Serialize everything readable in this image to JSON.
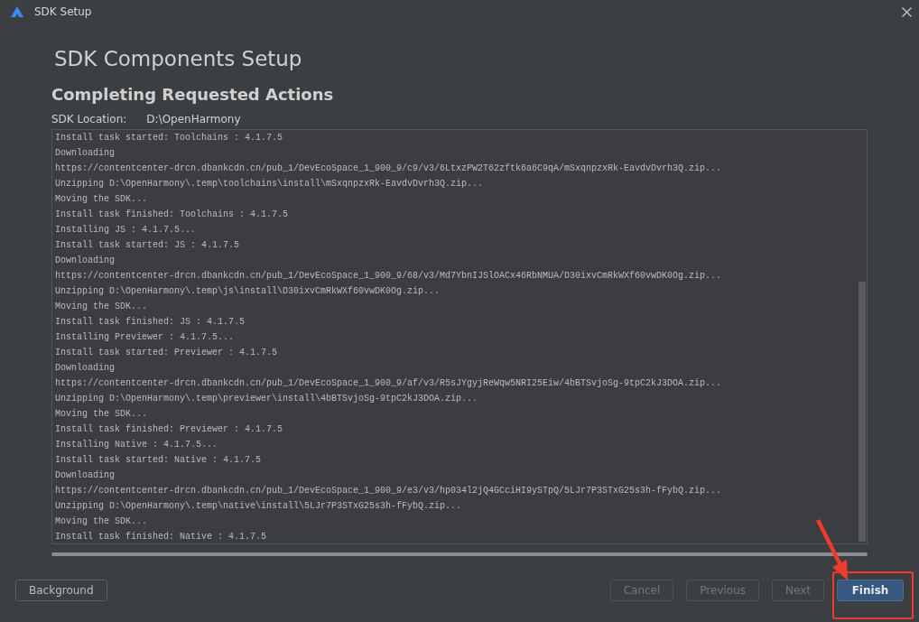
{
  "window": {
    "title": "SDK Setup"
  },
  "page_title": "SDK Components Setup",
  "section_title": "Completing Requested Actions",
  "sdk_location": {
    "label": "SDK Location:",
    "value": "D:\\OpenHarmony"
  },
  "log_lines": [
    "Install task started: Toolchains : 4.1.7.5",
    "Downloading",
    "https://contentcenter-drcn.dbankcdn.cn/pub_1/DevEcoSpace_1_900_9/c9/v3/6LtxzPW2T62zftk6a6C9qA/mSxqnpzxRk-EavdvDvrh3Q.zip...",
    "Unzipping D:\\OpenHarmony\\.temp\\toolchains\\install\\mSxqnpzxRk-EavdvDvrh3Q.zip...",
    "Moving the SDK...",
    "Install task finished: Toolchains : 4.1.7.5",
    "Installing JS : 4.1.7.5...",
    "Install task started: JS : 4.1.7.5",
    "Downloading",
    "https://contentcenter-drcn.dbankcdn.cn/pub_1/DevEcoSpace_1_900_9/68/v3/Md7YbnIJSlOACx46RbNMUA/D30ixvCmRkWXf60vwDK0Og.zip...",
    "Unzipping D:\\OpenHarmony\\.temp\\js\\install\\D30ixvCmRkWXf60vwDK0Og.zip...",
    "Moving the SDK...",
    "Install task finished: JS : 4.1.7.5",
    "Installing Previewer : 4.1.7.5...",
    "Install task started: Previewer : 4.1.7.5",
    "Downloading",
    "https://contentcenter-drcn.dbankcdn.cn/pub_1/DevEcoSpace_1_900_9/af/v3/R5sJYgyjReWqw5NRI25Eiw/4bBTSvjoSg-9tpC2kJ3DOA.zip...",
    "Unzipping D:\\OpenHarmony\\.temp\\previewer\\install\\4bBTSvjoSg-9tpC2kJ3DOA.zip...",
    "Moving the SDK...",
    "Install task finished: Previewer : 4.1.7.5",
    "Installing Native : 4.1.7.5...",
    "Install task started: Native : 4.1.7.5",
    "Downloading",
    "https://contentcenter-drcn.dbankcdn.cn/pub_1/DevEcoSpace_1_900_9/e3/v3/hp034l2jQ4GCciHI9ySTpQ/5LJr7P3STxG25s3h-fFybQ.zip...",
    "Unzipping D:\\OpenHarmony\\.temp\\native\\install\\5LJr7P3STxG25s3h-fFybQ.zip...",
    "Moving the SDK...",
    "Install task finished: Native : 4.1.7.5"
  ],
  "left_button": {
    "label": "Background",
    "disabled": false
  },
  "buttons": [
    {
      "label": "Cancel",
      "disabled": true,
      "primary": false
    },
    {
      "label": "Previous",
      "disabled": true,
      "primary": false
    },
    {
      "label": "Next",
      "disabled": true,
      "primary": false
    },
    {
      "label": "Finish",
      "disabled": false,
      "primary": true
    }
  ]
}
